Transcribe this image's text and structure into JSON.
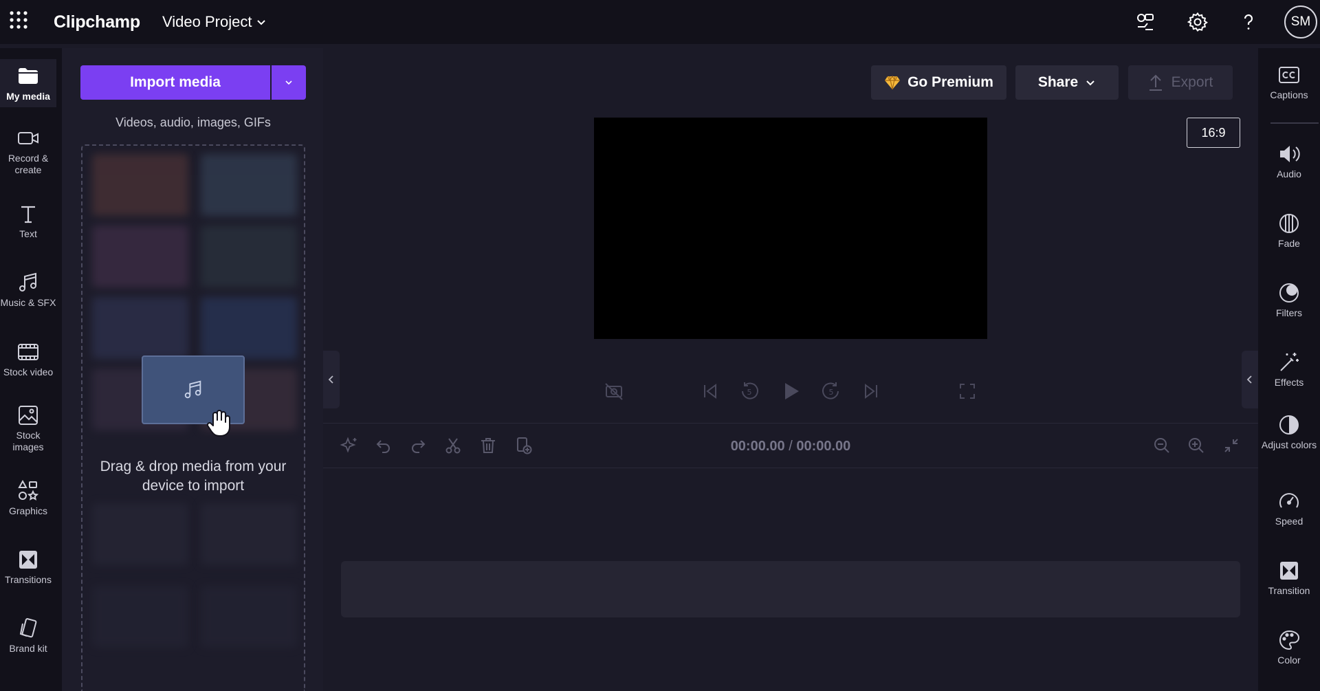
{
  "app": {
    "name": "Clipchamp",
    "project_title": "Video Project",
    "user_initials": "SM"
  },
  "left_nav": {
    "items": [
      {
        "label": "My media",
        "icon": "folder-icon",
        "active": true
      },
      {
        "label": "Record & create",
        "icon": "camera-icon"
      },
      {
        "label": "Text",
        "icon": "text-icon"
      },
      {
        "label": "Music & SFX",
        "icon": "music-note-icon"
      },
      {
        "label": "Stock video",
        "icon": "film-icon"
      },
      {
        "label": "Stock images",
        "icon": "image-icon"
      },
      {
        "label": "Graphics",
        "icon": "shapes-icon"
      },
      {
        "label": "Transitions",
        "icon": "transition-icon"
      },
      {
        "label": "Brand kit",
        "icon": "brand-kit-icon"
      }
    ]
  },
  "media_panel": {
    "import_label": "Import media",
    "import_subtitle": "Videos, audio, images, GIFs",
    "drop_text": "Drag & drop media from your device to import"
  },
  "preview": {
    "go_premium_label": "Go Premium",
    "share_label": "Share",
    "export_label": "Export",
    "aspect_ratio": "16:9"
  },
  "timeline": {
    "current_time": "00:00.00",
    "separator": "/",
    "total_time": "00:00.00"
  },
  "right_nav": {
    "items": [
      {
        "label": "Captions",
        "icon": "captions-icon"
      },
      {
        "label": "Audio",
        "icon": "speaker-icon"
      },
      {
        "label": "Fade",
        "icon": "fade-icon"
      },
      {
        "label": "Filters",
        "icon": "filters-icon"
      },
      {
        "label": "Effects",
        "icon": "magic-wand-icon"
      },
      {
        "label": "Adjust colors",
        "icon": "contrast-icon"
      },
      {
        "label": "Speed",
        "icon": "speedometer-icon"
      },
      {
        "label": "Transition",
        "icon": "transition-icon"
      },
      {
        "label": "Color",
        "icon": "palette-icon"
      }
    ]
  },
  "colors": {
    "accent": "#7b3ff2",
    "background": "#1b1a27",
    "topbar": "#12111a",
    "panel": "#1d1c2a",
    "premium_gem": "#f5b93c"
  }
}
